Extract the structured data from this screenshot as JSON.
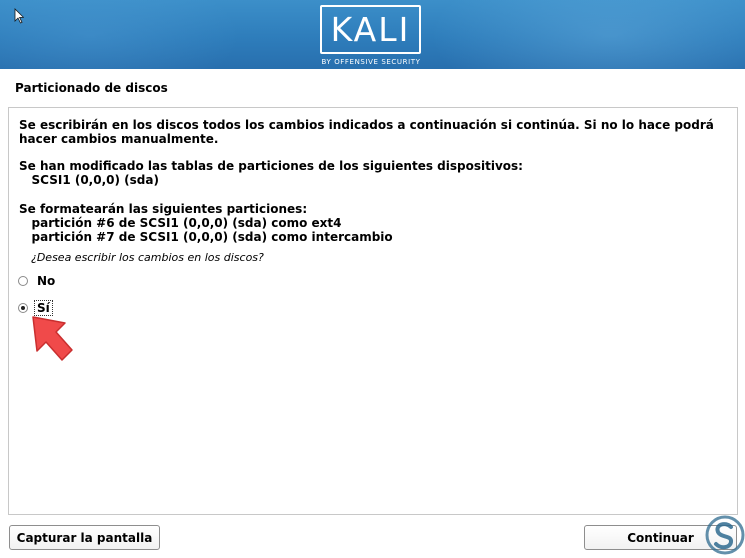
{
  "banner": {
    "logo_text": "KALI",
    "logo_subtitle": "BY OFFENSIVE SECURITY"
  },
  "page": {
    "title": "Particionado de discos"
  },
  "content": {
    "intro_line1": "Se escribirán en los discos todos los cambios indicados a continuación si continúa. Si no lo hace podrá",
    "intro_line2": "hacer cambios manualmente.",
    "modified_heading": "Se han modificado las tablas de particiones de los siguientes dispositivos:",
    "modified_device": "   SCSI1 (0,0,0) (sda)",
    "format_heading": "Se formatearán las siguientes particiones:",
    "format_items": [
      "   partición #6 de SCSI1 (0,0,0) (sda) como ext4",
      "   partición #7 de SCSI1 (0,0,0) (sda) como intercambio"
    ],
    "question": "¿Desea escribir los cambios en los discos?"
  },
  "options": [
    {
      "label": "No",
      "selected": false
    },
    {
      "label": "Sí",
      "selected": true
    }
  ],
  "buttons": {
    "capture": "Capturar la pantalla",
    "continue": "Continuar"
  },
  "icons": {
    "pointer": "red-arrow-pointer-icon",
    "cursor": "mouse-cursor-icon",
    "watermark": "solvetic-logo-icon"
  },
  "colors": {
    "banner": "#2e7dbb",
    "arrow": "#f04a4a",
    "watermark": "#2f6b8f"
  }
}
